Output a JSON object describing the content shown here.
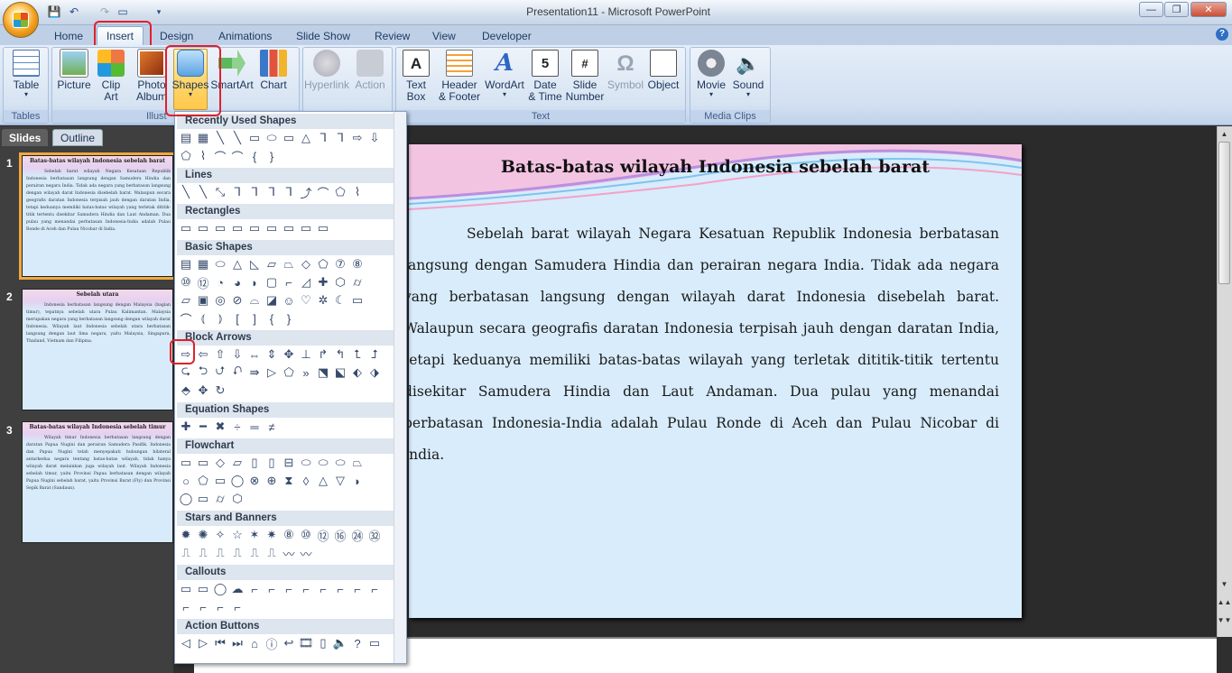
{
  "window": {
    "title": "Presentation11 - Microsoft PowerPoint",
    "minimize": "—",
    "restore": "❐",
    "close": "✕",
    "help": "?"
  },
  "qat": {
    "save": "💾",
    "undo": "↶",
    "redo": "↷",
    "more": "▾"
  },
  "tabs": [
    "Home",
    "Insert",
    "Design",
    "Animations",
    "Slide Show",
    "Review",
    "View",
    "Developer"
  ],
  "ribbon": {
    "groups": {
      "tables": "Tables",
      "illustrations": "Illust",
      "text": "Text",
      "media": "Media Clips"
    },
    "buttons": {
      "table": "Table",
      "picture": "Picture",
      "clipart": "Clip\nArt",
      "photoalbum": "Photo\nAlbum",
      "shapes": "Shapes",
      "smartart": "SmartArt",
      "chart": "Chart",
      "hyperlink": "Hyperlink",
      "action": "Action",
      "textbox": "Text\nBox",
      "headerfooter": "Header\n& Footer",
      "wordart": "WordArt",
      "datetime": "Date\n& Time",
      "slidenumber": "Slide\nNumber",
      "symbol": "Symbol",
      "object": "Object",
      "movie": "Movie",
      "sound": "Sound"
    }
  },
  "panel": {
    "tab_slides": "Slides",
    "tab_outline": "Outline",
    "close": "✕"
  },
  "thumbnails": [
    {
      "num": "1",
      "title": "Batas-batas wilayah Indonesia sebelah barat",
      "body": "Sebelah barat wilayah Negara Kesatuan Republik Indonesia berbatasan langsung dengan Samudera Hindia dan perairan negara India. Tidak ada negara yang berbatasan langsung dengan wilayah darat Indonesia disebelah barat. Walaupun secara geografis daratan Indonesia terpisah jauh dengan daratan India, tetapi keduanya memiliki batas-batas wilayah yang terletak dititik-titik tertentu disekitar Samudera Hindia dan Laut Andaman. Dua pulau yang menandai perbatasan Indonesia-India adalah Pulau Ronde di Aceh dan Pulau Nicobar di India."
    },
    {
      "num": "2",
      "title": "Sebelah utara",
      "body": "Indonesia berbatasan langsung dengan Malaysia (bagian timur), tepatnya sebelah utara Pulau Kalimantan. Malaysia merupakan negara yang berbatasan langsung dengan wilayah darat Indonesia. Wilayah laut Indonesia sebelah utara berbatasan langsung dengan laut lima negara, yaitu Malaysia, Singapura, Thailand, Vietnam dan Filipina."
    },
    {
      "num": "3",
      "title": "Batas-batas wilayah Indonesia sebelah timur",
      "body": "Wilayah timur Indonesia berbatasan langsung dengan daratan Papua Nugini dan perairan Samudera Pasifik. Indonesia dan Papua Nugini telah menyepakati hubungan bilateral antarkedua negara tentang batas-batas wilayah, tidak hanya wilayah darat melainkan juga wilayah laut. Wilayah Indonesia sebelah timur, yaitu Provinsi Papua berbatasan dengan wilayah Papua Nugini sebelah barat, yaitu Provinsi Barat (Fly) dan Provinsi Sepik Barat (Sandaun)."
    }
  ],
  "slide": {
    "title": "Batas-batas wilayah Indonesia sebelah barat",
    "body": "Sebelah barat wilayah Negara Kesatuan Republik Indonesia berbatasan langsung dengan Samudera Hindia dan perairan negara India. Tidak ada negara yang berbatasan langsung dengan wilayah darat Indonesia disebelah barat. Walaupun secara geografis daratan Indonesia terpisah jauh dengan daratan India, tetapi keduanya memiliki  batas-batas wilayah yang terletak dititik-titik tertentu disekitar Samudera Hindia dan Laut Andaman.  Dua pulau yang menandai perbatasan Indonesia-India  adalah Pulau Ronde di Aceh dan Pulau Nicobar di India."
  },
  "gallery": {
    "sections": [
      "Recently Used Shapes",
      "Lines",
      "Rectangles",
      "Basic Shapes",
      "Block Arrows",
      "Equation Shapes",
      "Flowchart",
      "Stars and Banners",
      "Callouts",
      "Action Buttons"
    ],
    "rows": [
      [
        "▤",
        "▦",
        "╲",
        "╲",
        "▭",
        "⬭",
        "▭",
        "△",
        "ᒣ",
        "ᒣ",
        "⇨",
        "⇩"
      ],
      [
        "⬠",
        "⌇",
        "⌒",
        "⌒",
        "{",
        "}"
      ],
      [
        "╲",
        "╲",
        "⤡",
        "ᒣ",
        "ᒣ",
        "ᒣ",
        "ᒣ",
        "⤴",
        "⌒",
        "⬠",
        "⌇"
      ],
      [
        "▭",
        "▭",
        "▭",
        "▭",
        "▭",
        "▭",
        "▭",
        "▭",
        "▭"
      ],
      [
        "▤",
        "▦",
        "⬭",
        "△",
        "◺",
        "▱",
        "⏢",
        "◇",
        "⬠",
        "⑦",
        "⑧"
      ],
      [
        "⑩",
        "⑫",
        "◔",
        "◕",
        "◗",
        "▢",
        "⌐",
        "◿",
        "✚",
        "⬡",
        "⌭"
      ],
      [
        "▱",
        "▣",
        "◎",
        "⊘",
        "⌓",
        "◪",
        "☺",
        "♡",
        "✲",
        "☾",
        "▭"
      ],
      [
        "⌒",
        "⦅",
        "⦆",
        "[",
        "]",
        "{",
        "}"
      ],
      [
        "⇨",
        "⇦",
        "⇧",
        "⇩",
        "⇔",
        "⇕",
        "✥",
        "⊥",
        "↱",
        "↰",
        "⮤",
        "⮥"
      ],
      [
        "⮎",
        "⮌",
        "⮍",
        "⮏",
        "⇛",
        "▷",
        "⬠",
        "»",
        "⬔",
        "⬕",
        "⬖",
        "⬗"
      ],
      [
        "⬘",
        "✥",
        "↻"
      ],
      [
        "✚",
        "━",
        "✖",
        "÷",
        "═",
        "≠"
      ],
      [
        "▭",
        "▭",
        "◇",
        "▱",
        "▯",
        "▯",
        "⊟",
        "⬭",
        "⬭",
        "⬭",
        "⏢"
      ],
      [
        "○",
        "⬠",
        "▭",
        "◯",
        "⊗",
        "⊕",
        "⧗",
        "◊",
        "△",
        "▽",
        "◗"
      ],
      [
        "◯",
        "▭",
        "⌭",
        "⬡"
      ],
      [
        "✹",
        "✺",
        "✧",
        "☆",
        "✶",
        "✷",
        "⑧",
        "⑩",
        "⑫",
        "⑯",
        "㉔",
        "㉜"
      ],
      [
        "⎍",
        "⎍",
        "⎍",
        "⎍",
        "⎍",
        "⎍",
        "〰",
        "〰"
      ],
      [
        "▭",
        "▭",
        "◯",
        "☁",
        "⌐",
        "⌐",
        "⌐",
        "⌐",
        "⌐",
        "⌐",
        "⌐",
        "⌐"
      ],
      [
        "⌐",
        "⌐",
        "⌐",
        "⌐"
      ],
      [
        "◁",
        "▷",
        "⏮",
        "⏭",
        "⌂",
        "ⓘ",
        "↩",
        "🎞",
        "▯",
        "🔈",
        "?",
        "▭"
      ]
    ]
  }
}
